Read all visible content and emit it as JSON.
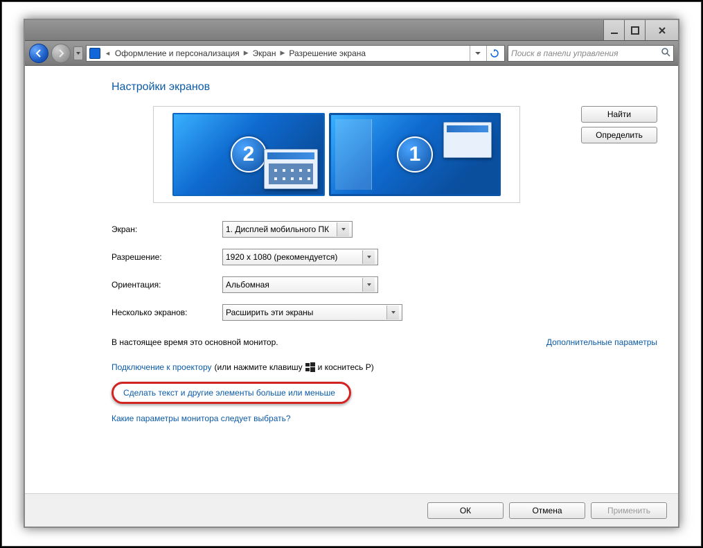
{
  "window": {
    "breadcrumb": [
      "Оформление и персонализация",
      "Экран",
      "Разрешение экрана"
    ],
    "search_placeholder": "Поиск в панели управления"
  },
  "page": {
    "title": "Настройки экранов",
    "monitors": {
      "primary_badge": "1",
      "secondary_badge": "2"
    },
    "buttons": {
      "detect": "Найти",
      "identify": "Определить"
    },
    "fields": {
      "display_label": "Экран:",
      "display_value": "1. Дисплей мобильного ПК",
      "resolution_label": "Разрешение:",
      "resolution_value": "1920 x 1080 (рекомендуется)",
      "orientation_label": "Ориентация:",
      "orientation_value": "Альбомная",
      "multiple_label": "Несколько экранов:",
      "multiple_value": "Расширить эти экраны"
    },
    "primary_note": "В настоящее время это основной монитор.",
    "advanced_link": "Дополнительные параметры",
    "projector_link": "Подключение к проектору",
    "projector_tail_pre": " (или нажмите клавишу ",
    "projector_tail_post": " и коснитесь P)",
    "text_size_link": "Сделать текст и другие элементы больше или меньше",
    "which_settings_link": "Какие параметры монитора следует выбрать?"
  },
  "footer": {
    "ok": "ОК",
    "cancel": "Отмена",
    "apply": "Применить"
  }
}
